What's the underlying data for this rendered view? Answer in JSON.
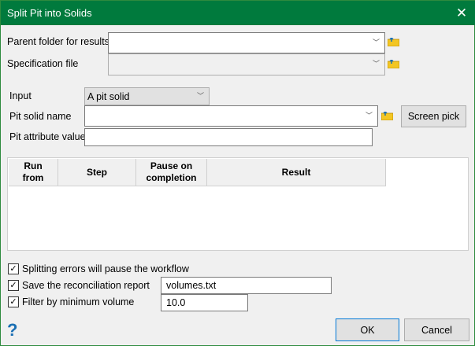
{
  "window": {
    "title": "Split Pit into Solids"
  },
  "form": {
    "parent_folder_label": "Parent folder for results",
    "parent_folder_value": "",
    "spec_file_label": "Specification file",
    "spec_file_value": "",
    "input_label": "Input",
    "input_value": "A pit solid",
    "pit_solid_label": "Pit solid name",
    "pit_solid_value": "",
    "screen_pick_label": "Screen pick",
    "pit_attr_label": "Pit attribute value",
    "pit_attr_value": ""
  },
  "table": {
    "columns": [
      "Run\nfrom",
      "Step",
      "Pause on\ncompletion",
      "Result"
    ],
    "rows": []
  },
  "options": {
    "pause_label": "Splitting errors will pause the workflow",
    "pause_checked": true,
    "save_label": "Save the reconciliation report",
    "save_checked": true,
    "save_value": "volumes.txt",
    "filter_label": "Filter by minimum volume",
    "filter_checked": true,
    "filter_value": "10.0"
  },
  "footer": {
    "ok_label": "OK",
    "cancel_label": "Cancel"
  },
  "colors": {
    "titlebar": "#007a3d",
    "accent": "#0078d7"
  }
}
